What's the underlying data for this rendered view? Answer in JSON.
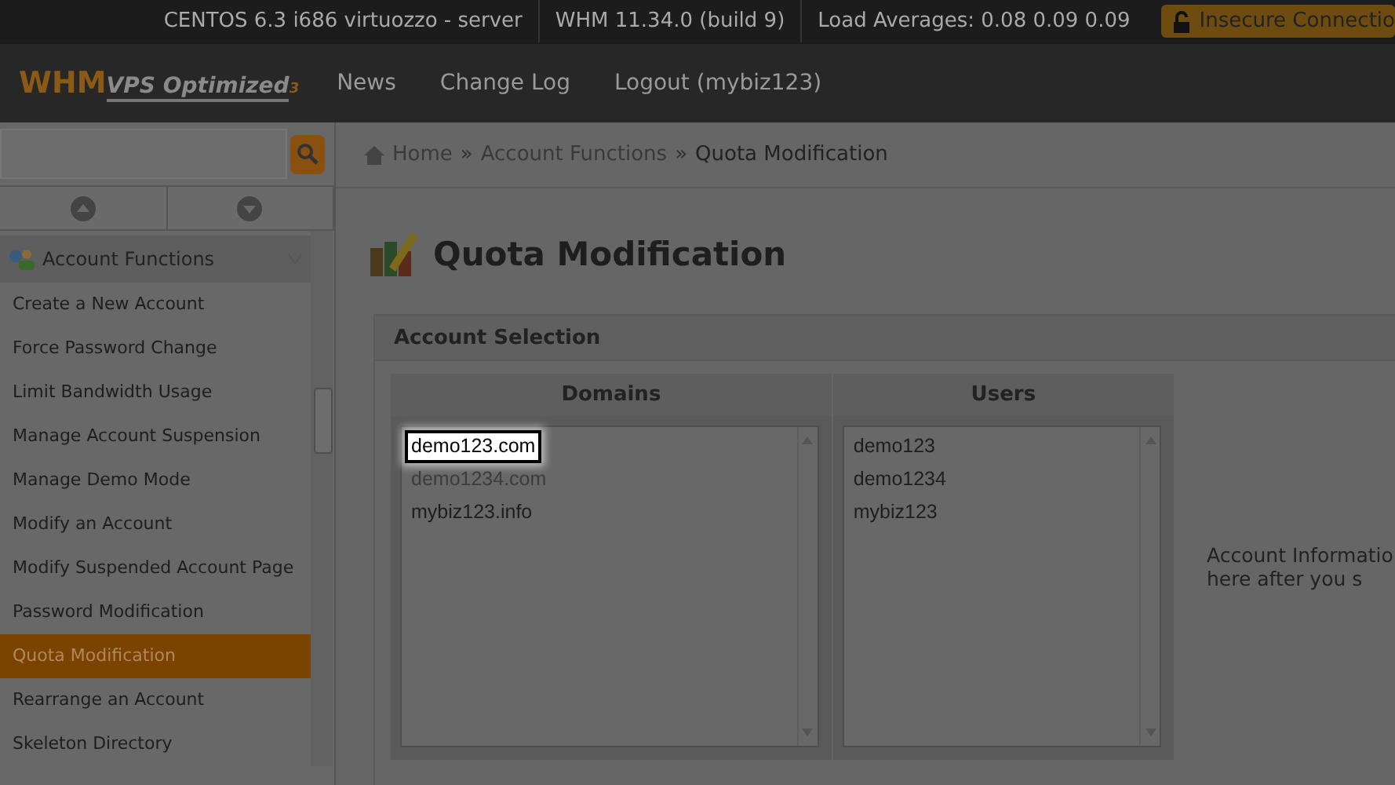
{
  "top_bar": {
    "items": [
      "CENTOS 6.3 i686 virtuozzo - server",
      "WHM 11.34.0 (build 9)",
      "Load Averages: 0.08 0.09 0.09"
    ],
    "security_badge": "Insecure Connectio"
  },
  "nav": {
    "logo": "WHM",
    "logo_sub": "VPS Optimized",
    "logo_mark": "3",
    "links": [
      "News",
      "Change Log",
      "Logout (mybiz123)"
    ]
  },
  "breadcrumb": [
    "Home",
    "Account Functions",
    "Quota Modification"
  ],
  "breadcrumb_separator": "»",
  "sidebar": {
    "group": "Account Functions",
    "items": [
      {
        "label": "Create a New Account",
        "selected": false
      },
      {
        "label": "Force Password Change",
        "selected": false
      },
      {
        "label": "Limit Bandwidth Usage",
        "selected": false
      },
      {
        "label": "Manage Account Suspension",
        "selected": false
      },
      {
        "label": "Manage Demo Mode",
        "selected": false
      },
      {
        "label": "Modify an Account",
        "selected": false
      },
      {
        "label": "Modify Suspended Account Page",
        "selected": false
      },
      {
        "label": "Password Modification",
        "selected": false
      },
      {
        "label": "Quota Modification",
        "selected": true
      },
      {
        "label": "Rearrange an Account",
        "selected": false
      },
      {
        "label": "Skeleton Directory",
        "selected": false
      }
    ]
  },
  "page_title": "Quota Modification",
  "panel": {
    "title": "Account Selection",
    "domains": {
      "heading": "Domains",
      "items": [
        {
          "label": "demo123.com",
          "highlighted": true
        },
        {
          "label": "demo1234.com",
          "highlighted": false
        },
        {
          "label": "mybiz123.info",
          "highlighted": false
        }
      ]
    },
    "users": {
      "heading": "Users",
      "items": [
        {
          "label": "demo123",
          "highlighted": false
        },
        {
          "label": "demo1234",
          "highlighted": false
        },
        {
          "label": "mybiz123",
          "highlighted": false
        }
      ]
    },
    "info_lines": [
      "Account Informatio",
      "here after you s"
    ]
  }
}
